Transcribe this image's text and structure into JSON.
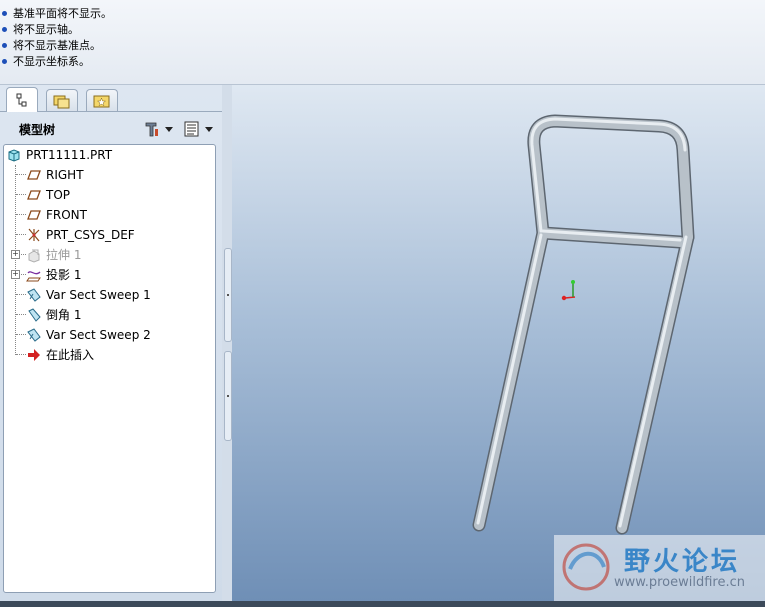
{
  "messages": [
    "基准平面将不显示。",
    "将不显示轴。",
    "将不显示基准点。",
    "不显示坐标系。"
  ],
  "tabs": [
    {
      "icon": "model-tree-icon"
    },
    {
      "icon": "folder-browser-icon"
    },
    {
      "icon": "favorites-folder-icon"
    }
  ],
  "tree_header": {
    "title": "模型树",
    "settings_icon": "tree-settings-icon",
    "show_icon": "tree-show-icon"
  },
  "tree": {
    "root": {
      "label": "PRT11111.PRT",
      "icon": "part-icon"
    },
    "items": [
      {
        "label": "RIGHT",
        "icon": "datum-plane-icon",
        "state": "normal"
      },
      {
        "label": "TOP",
        "icon": "datum-plane-icon",
        "state": "normal"
      },
      {
        "label": "FRONT",
        "icon": "datum-plane-icon",
        "state": "normal"
      },
      {
        "label": "PRT_CSYS_DEF",
        "icon": "csys-icon",
        "state": "normal"
      },
      {
        "label": "拉伸 1",
        "icon": "extrude-icon",
        "state": "suppressed",
        "expandable": true
      },
      {
        "label": "投影 1",
        "icon": "projection-icon",
        "state": "normal",
        "expandable": true
      },
      {
        "label": "Var Sect Sweep 1",
        "icon": "sweep-icon",
        "state": "normal"
      },
      {
        "label": "倒角 1",
        "icon": "chamfer-icon",
        "state": "normal"
      },
      {
        "label": "Var Sect Sweep 2",
        "icon": "sweep-icon",
        "state": "normal"
      },
      {
        "label": "在此插入",
        "icon": "insert-here-arrow-icon",
        "state": "normal"
      }
    ]
  },
  "viewport": {
    "model": "tube-frame",
    "colors": {
      "bg_top": "#dfe8f2",
      "bg_bottom": "#6f8fb6",
      "tube": "#a9b3bd"
    }
  },
  "watermark": {
    "text": "野火论坛",
    "url": "www.proewildfire.cn"
  }
}
